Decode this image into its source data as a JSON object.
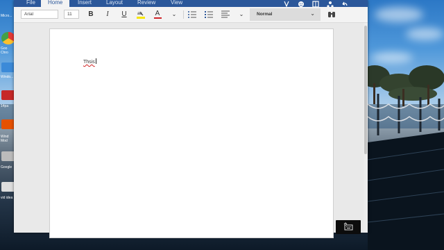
{
  "ribbon": {
    "tabs": [
      {
        "label": "File"
      },
      {
        "label": "Home"
      },
      {
        "label": "Insert"
      },
      {
        "label": "Layout"
      },
      {
        "label": "Review"
      },
      {
        "label": "View"
      }
    ],
    "active_tab": "Home",
    "accent_color": "#2b579a"
  },
  "toolbar": {
    "font_name": "Arial",
    "font_size": "11",
    "bold_glyph": "B",
    "italic_glyph": "I",
    "underline_glyph": "U",
    "font_color_glyph": "A",
    "font_color": "#d0242a",
    "highlight_color": "#f7e600",
    "style_name": "Normal"
  },
  "document": {
    "text": "Thsis"
  },
  "desktop_icons": [
    {
      "label": "Micro...",
      "color": "#2d7d46"
    },
    {
      "label": "Goo Chro",
      "color": "#4caf50"
    },
    {
      "label": "Windo...",
      "color": "#3b8ad8"
    },
    {
      "label": "14pa",
      "color": "#c62828"
    },
    {
      "label": "Wind Mod",
      "color": "#e65100"
    },
    {
      "label": "Google",
      "color": "#bbbbbb"
    },
    {
      "label": "vid idea",
      "color": "#dddddd"
    }
  ]
}
